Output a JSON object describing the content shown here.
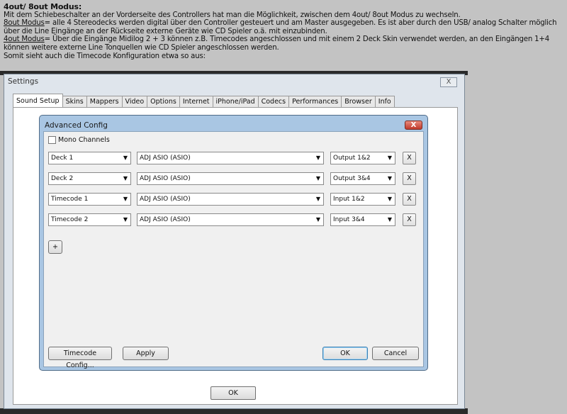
{
  "article": {
    "heading": "4out/ 8out Modus:",
    "line1": "Mit dem Schiebeschalter an der Vorderseite des Controllers hat man die Möglichkeit, zwischen dem 4out/ 8out Modus zu wechseln.",
    "mode8_label": "8out Modus",
    "mode8_text": "= alle 4 Stereodecks werden digital über den Controller gesteuert und am Master ausgegeben. Es ist aber durch den USB/ analog Schalter möglich über die Line Eingänge an der Rückseite externe Geräte wie CD Spieler o.ä. mit einzubinden.",
    "mode4_label": "4out Modus",
    "mode4_text": "= Über die Eingänge Midilog 2 + 3 können z.B. Timecodes angeschlossen und mit einem 2 Deck Skin verwendet werden, an den Eingängen 1+4 können weitere externe Line Tonquellen wie CD Spieler angeschlossen werden.",
    "last": "Somit sieht auch die Timecode Konfiguration etwa so aus:"
  },
  "settings": {
    "title": "Settings",
    "close": "X",
    "tabs": [
      "Sound Setup",
      "Skins",
      "Mappers",
      "Video",
      "Options",
      "Internet",
      "iPhone/iPad",
      "Codecs",
      "Performances",
      "Browser",
      "Info"
    ],
    "ok": "OK"
  },
  "advanced": {
    "title": "Advanced Config",
    "close": "X",
    "mono": "Mono Channels",
    "rows": [
      {
        "channel": "Deck 1",
        "device": "ADJ ASIO (ASIO)",
        "port": "Output 1&2",
        "remove": "X"
      },
      {
        "channel": "Deck 2",
        "device": "ADJ ASIO (ASIO)",
        "port": "Output 3&4",
        "remove": "X"
      },
      {
        "channel": "Timecode 1",
        "device": "ADJ ASIO (ASIO)",
        "port": "Input 1&2",
        "remove": "X"
      },
      {
        "channel": "Timecode 2",
        "device": "ADJ ASIO (ASIO)",
        "port": "Input 3&4",
        "remove": "X"
      }
    ],
    "add": "+",
    "timecode_config": "Timecode Config...",
    "apply": "Apply",
    "ok": "OK",
    "cancel": "Cancel"
  }
}
